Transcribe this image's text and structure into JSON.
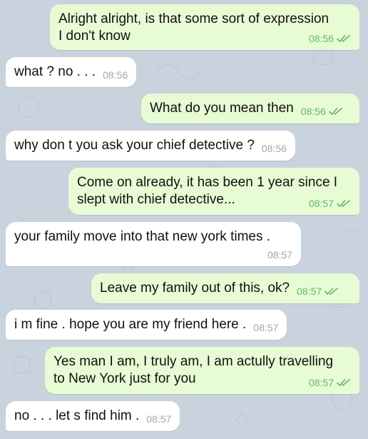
{
  "colors": {
    "wallpaper": "#c9d3dd",
    "outgoing_bubble": "#e7fbd4",
    "incoming_bubble": "#ffffff",
    "outgoing_meta": "#67b766",
    "incoming_meta": "#a0a7ad"
  },
  "messages": [
    {
      "direction": "out",
      "text": "Alright alright, is that some sort of expression\nI don't know",
      "time": "08:56",
      "status_icon": "double-check-icon"
    },
    {
      "direction": "in",
      "text": "what ? no . . .",
      "time": "08:56"
    },
    {
      "direction": "out",
      "text": "What do you mean then",
      "time": "08:56",
      "status_icon": "double-check-icon"
    },
    {
      "direction": "in",
      "text": "why don t you ask your chief detective ?",
      "time": "08:56"
    },
    {
      "direction": "out",
      "text": "Come on already, it has been 1 year since I\nslept with chief detective...",
      "time": "08:57",
      "status_icon": "double-check-icon"
    },
    {
      "direction": "in",
      "text": "your family move into that new york times .",
      "time": "08:57"
    },
    {
      "direction": "out",
      "text": "Leave my family out of this, ok?",
      "time": "08:57",
      "status_icon": "double-check-icon"
    },
    {
      "direction": "in",
      "text": "i m fine . hope you are my friend here .",
      "time": "08:57"
    },
    {
      "direction": "out",
      "text": "Yes man I am, I truly am, I am actully travelling\nto New York just for you",
      "time": "08:57",
      "status_icon": "double-check-icon"
    },
    {
      "direction": "in",
      "text": "no . . . let s find him .",
      "time": "08:57"
    }
  ]
}
